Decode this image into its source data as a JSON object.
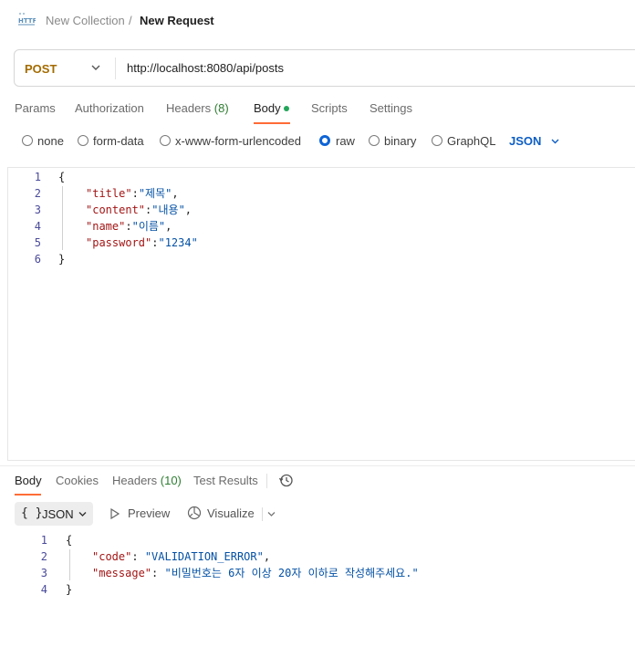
{
  "breadcrumb": {
    "collection": "New Collection",
    "separator": "/",
    "request": "New Request"
  },
  "request": {
    "method": "POST",
    "url": "http://localhost:8080/api/posts"
  },
  "request_tabs": {
    "params": "Params",
    "authorization": "Authorization",
    "headers": "Headers",
    "headers_count": "(8)",
    "body": "Body",
    "scripts": "Scripts",
    "settings": "Settings"
  },
  "body_types": {
    "none": "none",
    "form_data": "form-data",
    "urlencoded": "x-www-form-urlencoded",
    "raw": "raw",
    "binary": "binary",
    "graphql": "GraphQL",
    "selected": "raw",
    "format": "JSON"
  },
  "request_body": {
    "line_numbers": [
      "1",
      "2",
      "3",
      "4",
      "5",
      "6"
    ],
    "open": "{",
    "close": "}",
    "fields": [
      {
        "key": "\"title\"",
        "colon": ":",
        "value": "\"제목\"",
        "comma": ","
      },
      {
        "key": "\"content\"",
        "colon": ":",
        "value": "\"내용\"",
        "comma": ","
      },
      {
        "key": "\"name\"",
        "colon": ":",
        "value": "\"이름\"",
        "comma": ","
      },
      {
        "key": "\"password\"",
        "colon": ":",
        "value": "\"1234\"",
        "comma": ""
      }
    ]
  },
  "response_tabs": {
    "body": "Body",
    "cookies": "Cookies",
    "headers": "Headers",
    "headers_count": "(10)",
    "test_results": "Test Results"
  },
  "response_toolbar": {
    "format_icon": "{ }",
    "format": "JSON",
    "preview": "Preview",
    "visualize": "Visualize"
  },
  "response_body": {
    "line_numbers": [
      "1",
      "2",
      "3",
      "4"
    ],
    "open": "{",
    "close": "}",
    "fields": [
      {
        "key": "\"code\"",
        "colon": ": ",
        "value": "\"VALIDATION_ERROR\"",
        "comma": ","
      },
      {
        "key": "\"message\"",
        "colon": ": ",
        "value": "\"비밀번호는 6자 이상 20자 이하로 작성해주세요.\"",
        "comma": ""
      }
    ]
  },
  "colors": {
    "accent": "#ff6c37",
    "method": "#a36b00",
    "link": "#0e5ec4",
    "json_key": "#a31515",
    "json_string": "#0451a5",
    "count": "#2e7d32"
  }
}
